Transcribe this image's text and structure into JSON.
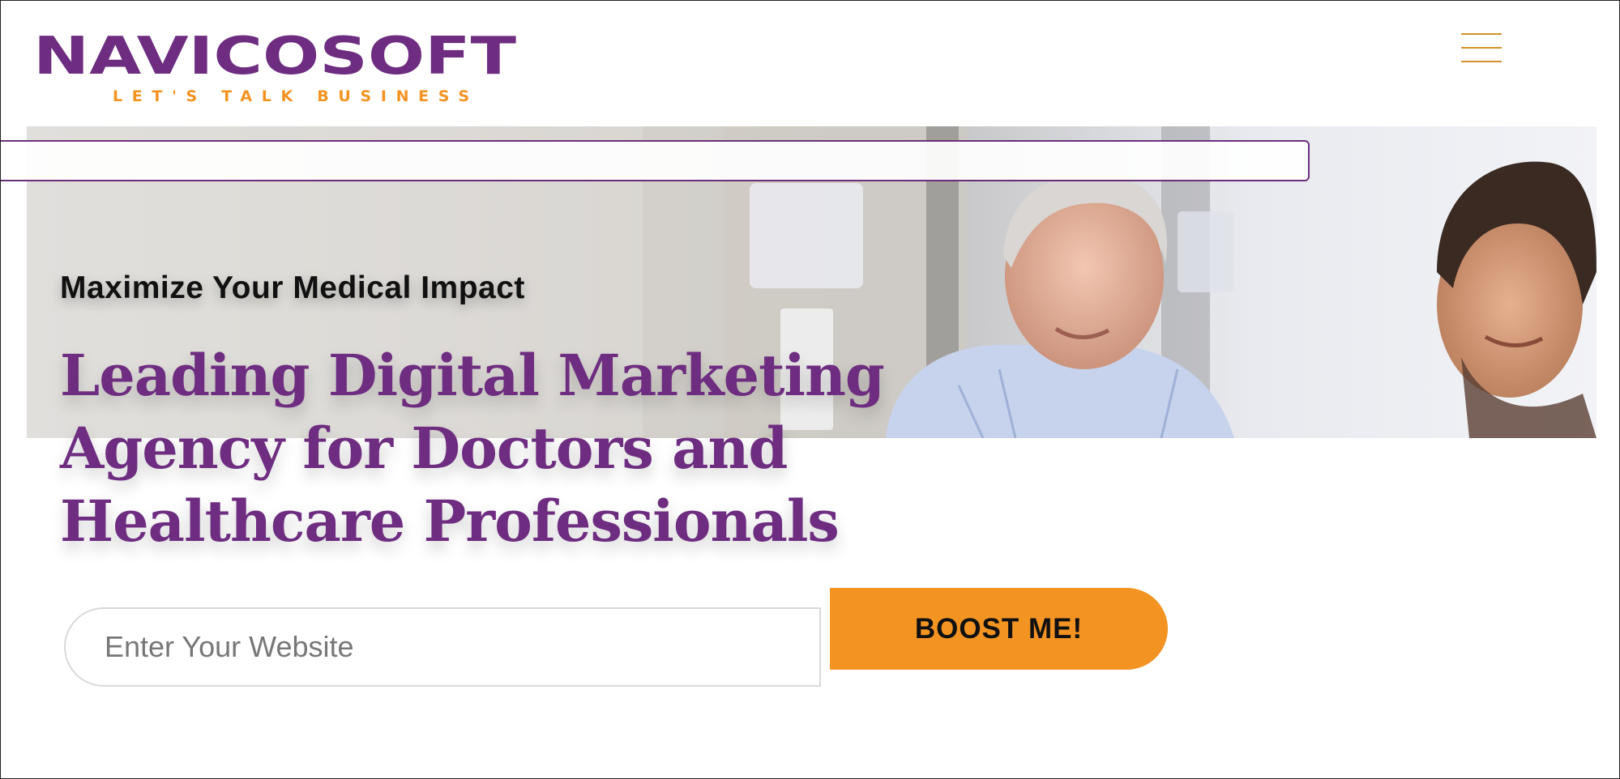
{
  "header": {
    "logo": {
      "name": "NAVICOSOFT",
      "tagline": "LET'S TALK BUSINESS",
      "icon": "navicosoft-logo"
    },
    "menu_icon": "hamburger-menu-icon"
  },
  "hero": {
    "kicker": "Maximize Your Medical Impact",
    "headline": "Leading Digital Marketing Agency for Doctors and Healthcare Professionals"
  },
  "form": {
    "website_placeholder": "Enter Your Website",
    "website_value": "",
    "submit_label": "BOOST ME!"
  },
  "colors": {
    "brand_purple": "#6e2d80",
    "brand_orange": "#f39322",
    "menu_icon": "#d3922b"
  }
}
